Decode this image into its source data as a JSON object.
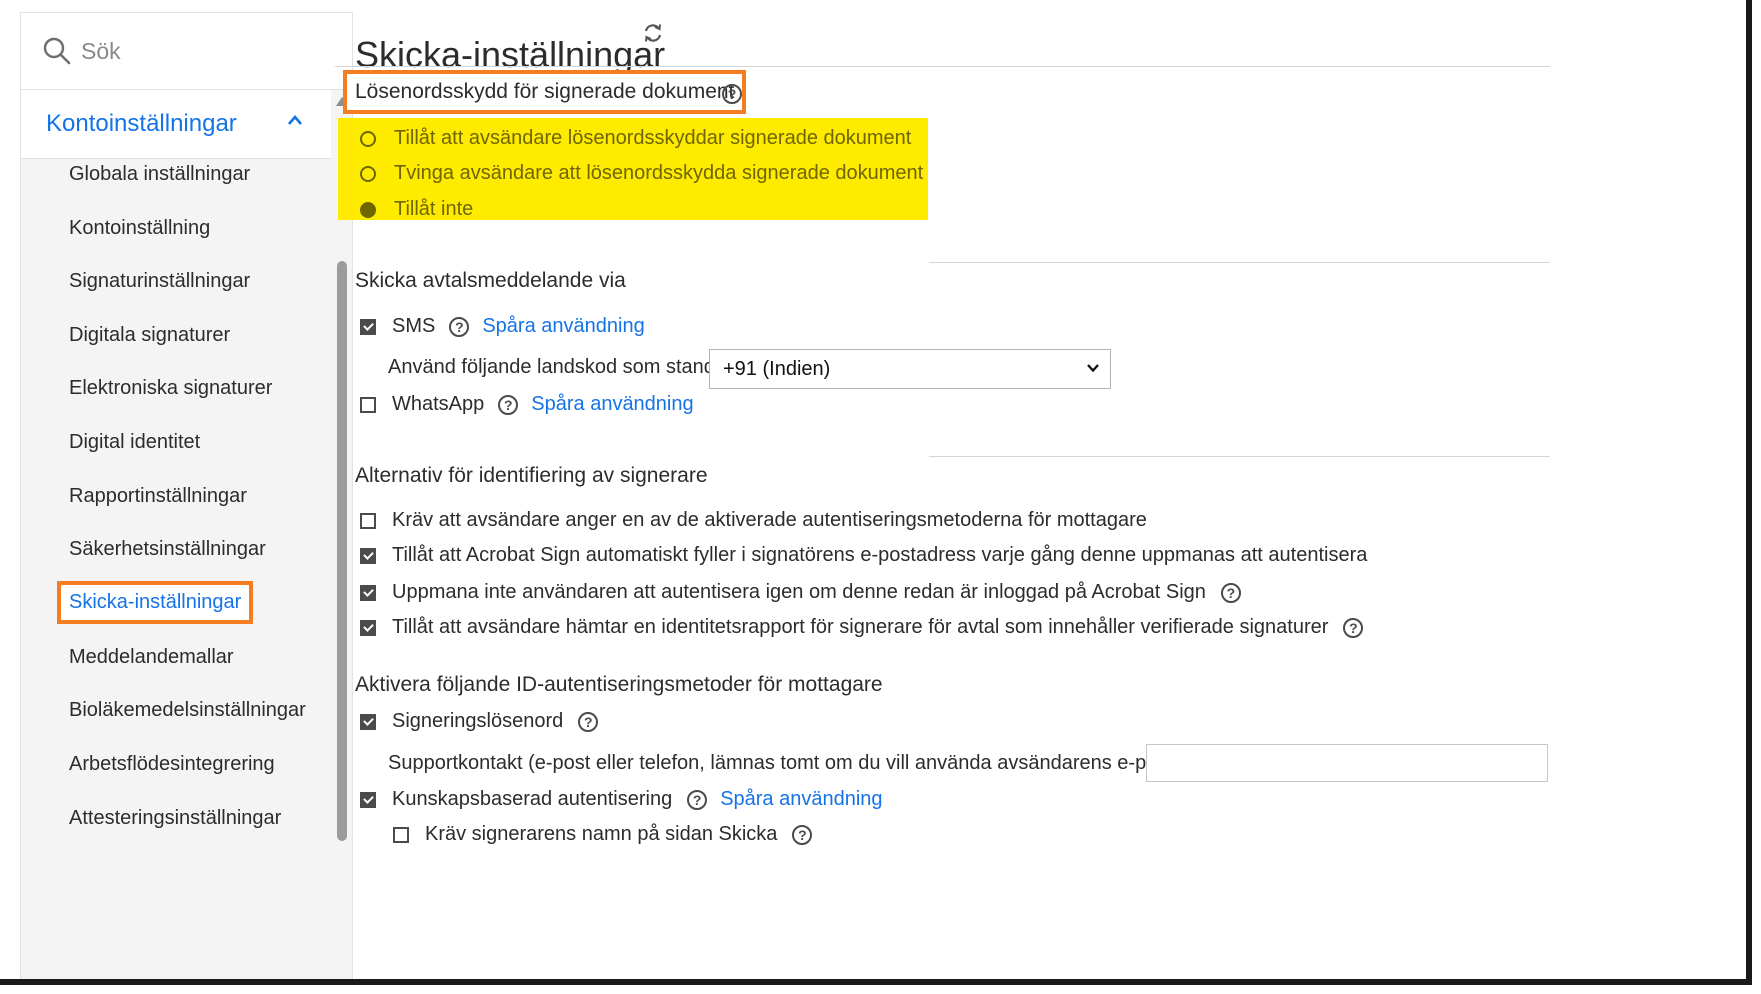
{
  "sidebar": {
    "search_placeholder": "Sök",
    "section_label": "Kontoinställningar",
    "items": [
      {
        "label": "Globala inställningar"
      },
      {
        "label": "Kontoinställning"
      },
      {
        "label": "Signaturinställningar"
      },
      {
        "label": "Digitala signaturer"
      },
      {
        "label": "Elektroniska signaturer"
      },
      {
        "label": "Digital identitet"
      },
      {
        "label": "Rapportinställningar"
      },
      {
        "label": "Säkerhetsinställningar"
      },
      {
        "label": "Skicka-inställningar"
      },
      {
        "label": "Meddelandemallar"
      },
      {
        "label": "Bioläkemedelsinställningar"
      },
      {
        "label": "Arbetsflödesintegrering"
      },
      {
        "label": "Attesteringsinställningar"
      }
    ],
    "active_item": "Skicka-inställningar"
  },
  "main": {
    "page_title": "Skicka-inställningar",
    "password_section": {
      "title": "Lösenordsskydd för signerade dokument",
      "options": [
        {
          "label": "Tillåt att avsändare lösenordsskyddar signerade dokument",
          "selected": false
        },
        {
          "label": "Tvinga avsändare att lösenordsskydda signerade dokument",
          "selected": false
        },
        {
          "label": "Tillåt inte",
          "selected": true
        }
      ]
    },
    "message_section": {
      "title": "Skicka avtalsmeddelande via",
      "sms_label": "SMS",
      "sms_checked": true,
      "sms_track_link": "Spåra användning",
      "country_code_label": "Använd följande landskod som standard:",
      "country_code_value": "+91 (Indien)",
      "whatsapp_label": "WhatsApp",
      "whatsapp_checked": false,
      "whatsapp_track_link": "Spåra användning"
    },
    "identification_section": {
      "title": "Alternativ för identifiering av signerare",
      "options": [
        {
          "label": "Kräv att avsändare anger en av de aktiverade autentiseringsmetoderna för mottagare",
          "checked": false
        },
        {
          "label": "Tillåt att Acrobat Sign automatiskt fyller i signatörens e-postadress varje gång denne uppmanas att autentisera",
          "checked": true
        },
        {
          "label": "Uppmana inte användaren att autentisera igen om denne redan är inloggad på Acrobat Sign",
          "checked": true
        },
        {
          "label": "Tillåt att avsändare hämtar en identitetsrapport för signerare för avtal som innehåller verifierade signaturer",
          "checked": true
        }
      ]
    },
    "auth_section": {
      "title": "Aktivera följande ID-autentiseringsmetoder för mottagare",
      "password_label": "Signeringslösenord",
      "password_checked": true,
      "support_label": "Supportkontakt (e-post eller telefon, lämnas tomt om du vill använda avsändarens e-postadress):",
      "support_value": "",
      "kba_label": "Kunskapsbaserad autentisering",
      "kba_checked": true,
      "kba_track_link": "Spåra användning",
      "require_name_label": "Kräv signerarens namn på sidan Skicka",
      "require_name_checked": false
    }
  },
  "colors": {
    "accent": "#1473e6",
    "highlight_box": "#f57c20",
    "highlight_fill": "#ffeb00"
  }
}
